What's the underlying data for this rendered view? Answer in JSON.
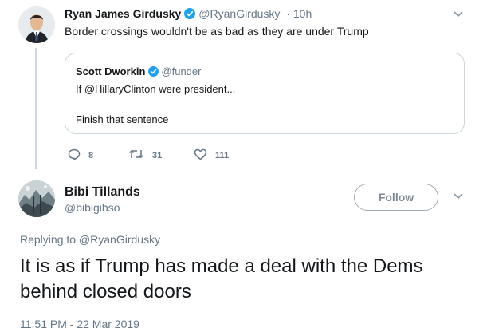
{
  "parent_tweet": {
    "author_name": "Ryan James Girdusky",
    "author_handle": "@RyanGirdusky",
    "time": "· 10h",
    "text": "Border crossings wouldn't be as bad as they are under Trump",
    "quoted": {
      "author_name": "Scott Dworkin",
      "author_handle": "@funder",
      "line1": "If @HillaryClinton were president...",
      "line2": "Finish that sentence"
    },
    "actions": {
      "replies": "8",
      "retweets": "31",
      "likes": "111"
    }
  },
  "main_tweet": {
    "author_name": "Bibi Tillands",
    "author_handle": "@bibigibso",
    "follow_label": "Follow",
    "replying_prefix": "Replying to",
    "replying_to": "@RyanGirdusky",
    "text": "It is as if Trump has made a deal with the Dems behind closed doors",
    "timestamp": "11:51 PM - 22 Mar 2019"
  },
  "colors": {
    "verified": "#1da1f2",
    "secondary_text": "#657786",
    "border": "#ccd6dd"
  },
  "icons": {
    "reply": "reply-icon",
    "retweet": "retweet-icon",
    "like": "heart-icon",
    "verified": "verified-badge-icon",
    "caret": "chevron-down-icon"
  }
}
